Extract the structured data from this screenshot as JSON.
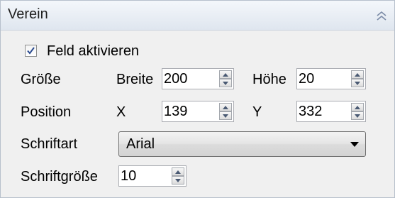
{
  "header": {
    "title": "Verein",
    "collapse_icon": "double-chevron-up-icon"
  },
  "enable": {
    "label": "Feld aktivieren",
    "checked": true
  },
  "size": {
    "label": "Größe",
    "width_label": "Breite",
    "width_value": "200",
    "height_label": "Höhe",
    "height_value": "20"
  },
  "position": {
    "label": "Position",
    "x_label": "X",
    "x_value": "139",
    "y_label": "Y",
    "y_value": "332"
  },
  "font": {
    "label": "Schriftart",
    "value": "Arial",
    "dropdown_icon": "triangle-down-icon"
  },
  "font_size": {
    "label": "Schriftgröße",
    "value": "10"
  }
}
